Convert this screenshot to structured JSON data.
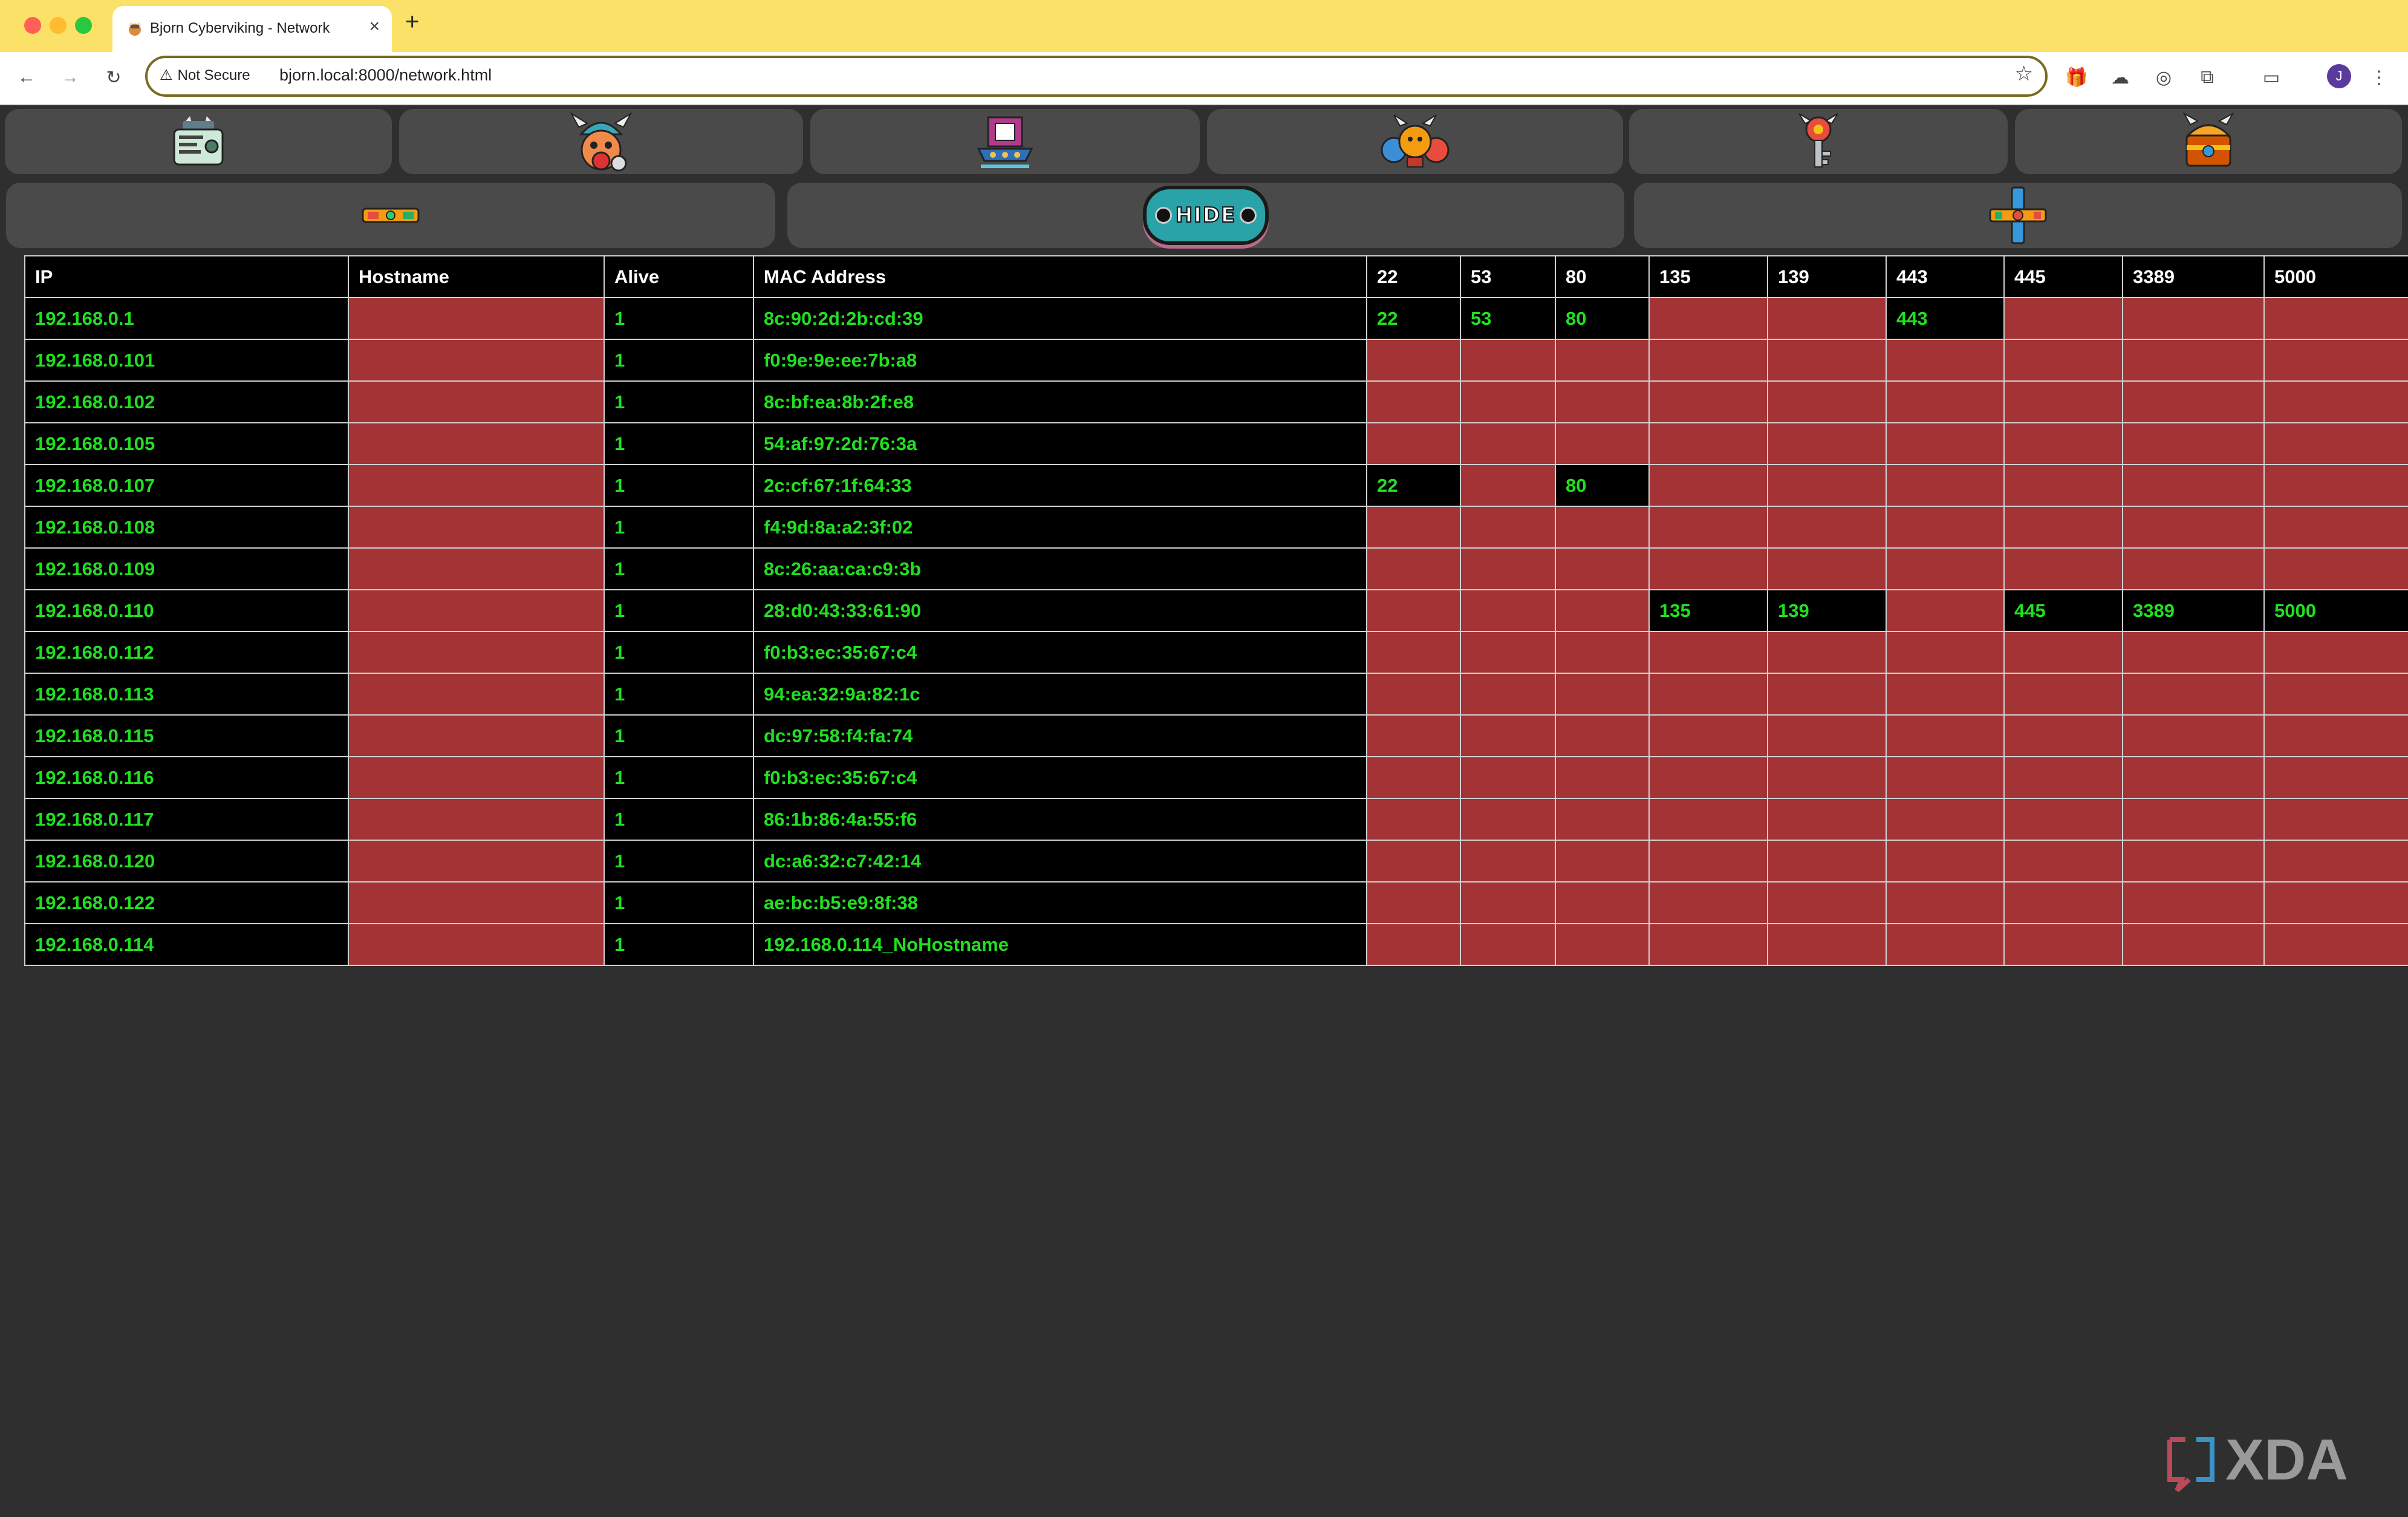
{
  "browser": {
    "tab_title": "Bjorn Cyberviking - Network",
    "security_label": "Not Secure",
    "url": "bjorn.local:8000/network.html",
    "profile_initial": "J"
  },
  "nav": {
    "top_buttons": [
      "viking-terminal-icon",
      "viking-gear-icon",
      "viking-ship-icon",
      "viking-trio-icon",
      "viking-key-icon",
      "viking-chest-icon"
    ],
    "second_row": {
      "left_icon": "horizontal-toolbar-icon",
      "center_label": "HIDE",
      "right_icon": "cross-toolbar-icon"
    }
  },
  "table": {
    "columns": [
      "IP",
      "Hostname",
      "Alive",
      "MAC Address",
      "22",
      "53",
      "80",
      "135",
      "139",
      "443",
      "445",
      "3389",
      "5000"
    ],
    "ports": [
      "22",
      "53",
      "80",
      "135",
      "139",
      "443",
      "445",
      "3389",
      "5000"
    ],
    "rows": [
      {
        "ip": "192.168.0.1",
        "hostname": "",
        "alive": "1",
        "mac": "8c:90:2d:2b:cd:39",
        "ports": {
          "22": "22",
          "53": "53",
          "80": "80",
          "443": "443"
        }
      },
      {
        "ip": "192.168.0.101",
        "hostname": "",
        "alive": "1",
        "mac": "f0:9e:9e:ee:7b:a8",
        "ports": {}
      },
      {
        "ip": "192.168.0.102",
        "hostname": "",
        "alive": "1",
        "mac": "8c:bf:ea:8b:2f:e8",
        "ports": {}
      },
      {
        "ip": "192.168.0.105",
        "hostname": "",
        "alive": "1",
        "mac": "54:af:97:2d:76:3a",
        "ports": {}
      },
      {
        "ip": "192.168.0.107",
        "hostname": "",
        "alive": "1",
        "mac": "2c:cf:67:1f:64:33",
        "ports": {
          "22": "22",
          "80": "80"
        }
      },
      {
        "ip": "192.168.0.108",
        "hostname": "",
        "alive": "1",
        "mac": "f4:9d:8a:a2:3f:02",
        "ports": {}
      },
      {
        "ip": "192.168.0.109",
        "hostname": "",
        "alive": "1",
        "mac": "8c:26:aa:ca:c9:3b",
        "ports": {}
      },
      {
        "ip": "192.168.0.110",
        "hostname": "",
        "alive": "1",
        "mac": "28:d0:43:33:61:90",
        "ports": {
          "135": "135",
          "139": "139",
          "445": "445",
          "3389": "3389",
          "5000": "5000"
        }
      },
      {
        "ip": "192.168.0.112",
        "hostname": "",
        "alive": "1",
        "mac": "f0:b3:ec:35:67:c4",
        "ports": {}
      },
      {
        "ip": "192.168.0.113",
        "hostname": "",
        "alive": "1",
        "mac": "94:ea:32:9a:82:1c",
        "ports": {}
      },
      {
        "ip": "192.168.0.115",
        "hostname": "",
        "alive": "1",
        "mac": "dc:97:58:f4:fa:74",
        "ports": {}
      },
      {
        "ip": "192.168.0.116",
        "hostname": "",
        "alive": "1",
        "mac": "f0:b3:ec:35:67:c4",
        "ports": {}
      },
      {
        "ip": "192.168.0.117",
        "hostname": "",
        "alive": "1",
        "mac": "86:1b:86:4a:55:f6",
        "ports": {}
      },
      {
        "ip": "192.168.0.120",
        "hostname": "",
        "alive": "1",
        "mac": "dc:a6:32:c7:42:14",
        "ports": {}
      },
      {
        "ip": "192.168.0.122",
        "hostname": "",
        "alive": "1",
        "mac": "ae:bc:b5:e9:8f:38",
        "ports": {}
      },
      {
        "ip": "192.168.0.114",
        "hostname": "",
        "alive": "1",
        "mac": "192.168.0.114_NoHostname",
        "ports": {}
      }
    ]
  },
  "colors": {
    "open_text": "#21e021",
    "closed_cell": "#a33335",
    "header_bg": "#000000",
    "page_bg": "#2f2f2f",
    "tabbar_bg": "#fce168"
  },
  "watermark": {
    "icon": "xda-logo-icon",
    "text": "XDA"
  }
}
